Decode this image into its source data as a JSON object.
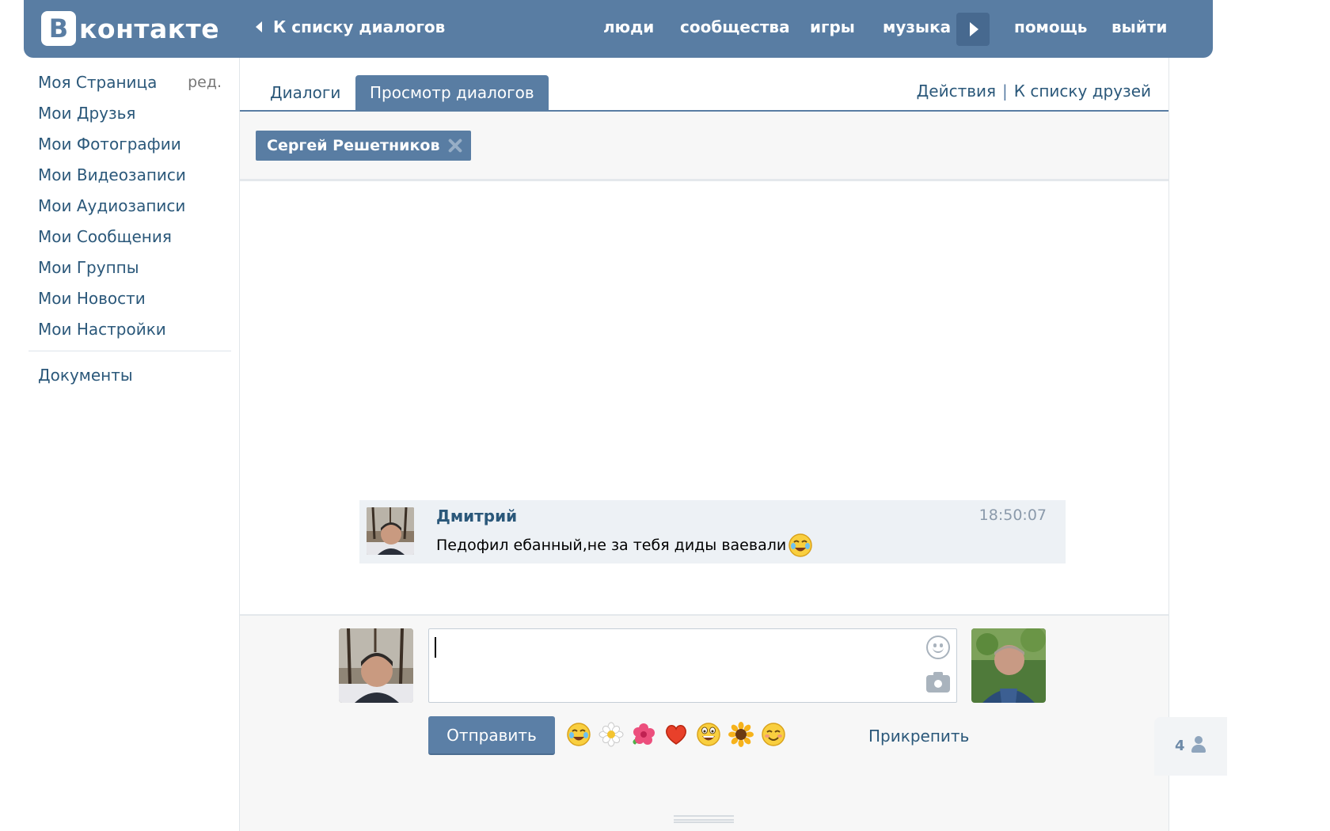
{
  "header": {
    "logo_letter": "В",
    "logo_text": "контакте",
    "back_label": "К списку диалогов",
    "nav": [
      "люди",
      "сообщества",
      "игры",
      "музыка",
      "помощь",
      "выйти"
    ]
  },
  "sidebar": {
    "edit_label": "ред.",
    "items": [
      "Моя Страница",
      "Мои Друзья",
      "Мои Фотографии",
      "Мои Видеозаписи",
      "Мои Аудиозаписи",
      "Мои Сообщения",
      "Мои Группы",
      "Мои Новости",
      "Мои Настройки"
    ],
    "extra": "Документы"
  },
  "tabs": {
    "dialogs": "Диалоги",
    "view": "Просмотр диалогов",
    "actions": "Действия",
    "separator": "|",
    "friends": "К списку друзей"
  },
  "filter": {
    "chip_label": "Сергей Решетников"
  },
  "message": {
    "author": "Дмитрий",
    "time": "18:50:07",
    "text": "Педофил ебанный,не за тебя диды ваевали"
  },
  "composer": {
    "send_label": "Отправить",
    "attach_label": "Прикрепить",
    "emojis": [
      "crying-laugh-emoji",
      "daisy-emoji",
      "hibiscus-emoji",
      "heart-emoji",
      "laughing-emoji",
      "sunflower-emoji",
      "blushing-emoji"
    ]
  },
  "online": {
    "count": "4"
  },
  "colors": {
    "brand": "#597da3",
    "link": "#2b587a",
    "message_bg": "#edf1f5",
    "panel_bg": "#f7f7f7"
  }
}
